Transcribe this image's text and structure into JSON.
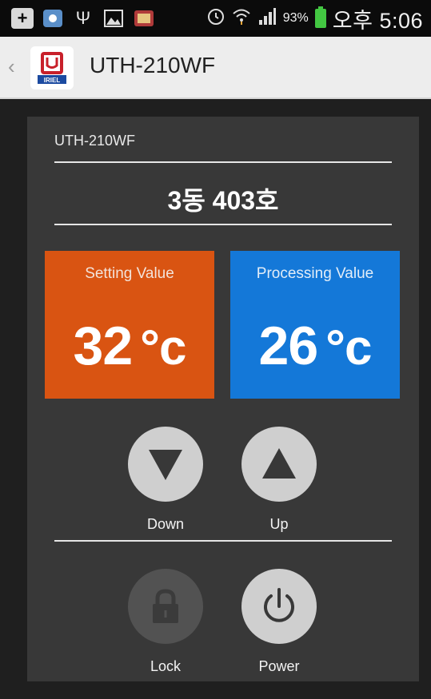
{
  "status_bar": {
    "battery_percent": "93%",
    "time": "오후 5:06",
    "icons": [
      "plus-icon",
      "cloud-icon",
      "usb-icon",
      "image-icon",
      "app-icon",
      "alarm-icon",
      "wifi-icon",
      "signal-icon",
      "battery-icon"
    ]
  },
  "action_bar": {
    "title": "UTH-210WF",
    "app_icon_text": "IRIEL"
  },
  "panel": {
    "device_label": "UTH-210WF",
    "location": "3동 403호",
    "setting": {
      "label": "Setting Value",
      "value": "32",
      "unit": "°c"
    },
    "processing": {
      "label": "Processing Value",
      "value": "26",
      "unit": "°c"
    },
    "buttons": {
      "down": "Down",
      "up": "Up",
      "lock": "Lock",
      "power": "Power"
    }
  },
  "colors": {
    "setting_bg": "#d95412",
    "processing_bg": "#1478d8",
    "panel_bg": "#383838"
  }
}
